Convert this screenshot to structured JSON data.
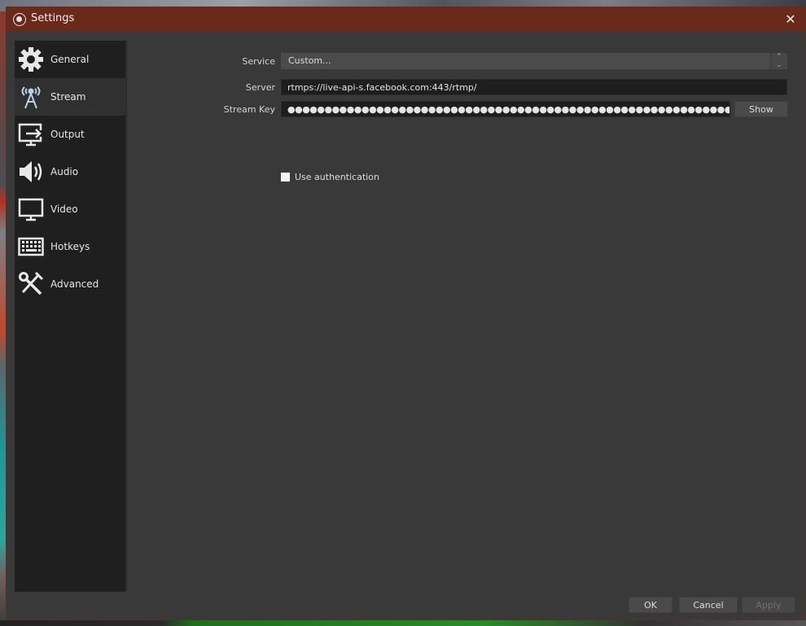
{
  "window": {
    "title": "Settings",
    "close_glyph": "✕"
  },
  "sidebar": {
    "selected": "Stream",
    "items": [
      {
        "label": "General",
        "icon": "gear-icon"
      },
      {
        "label": "Stream",
        "icon": "broadcast-tower-icon"
      },
      {
        "label": "Output",
        "icon": "output-monitor-icon"
      },
      {
        "label": "Audio",
        "icon": "speaker-icon"
      },
      {
        "label": "Video",
        "icon": "monitor-icon"
      },
      {
        "label": "Hotkeys",
        "icon": "keyboard-icon"
      },
      {
        "label": "Advanced",
        "icon": "wrench-screwdriver-icon"
      }
    ]
  },
  "stream": {
    "service_label": "Service",
    "service_value": "Custom...",
    "server_label": "Server",
    "server_value": "rtmps://live-api-s.facebook.com:443/rtmp/",
    "stream_key_label": "Stream Key",
    "stream_key_masked": "●●●●●●●●●●●●●●●●●●●●●●●●●●●●●●●●●●●●●●●●●●●●●●●●●●●●●●●●●●●●●●●●●●●●●●●●●●●●●●●●●●●●●●●●",
    "show_button": "Show",
    "use_auth_label": "Use authentication",
    "use_auth_checked": false
  },
  "footer": {
    "ok": "OK",
    "cancel": "Cancel",
    "apply": "Apply"
  }
}
